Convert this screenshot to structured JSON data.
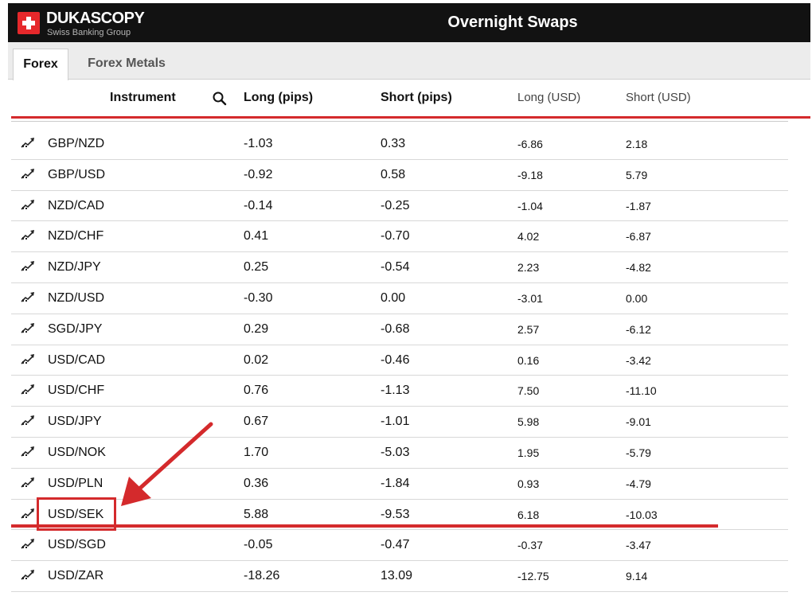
{
  "header": {
    "brand": "DUKASCOPY",
    "brand_sub": "Swiss Banking Group",
    "title": "Overnight Swaps",
    "brand_color": "#e6282b"
  },
  "tabs": [
    {
      "label": "Forex",
      "active": true
    },
    {
      "label": "Forex Metals",
      "active": false
    }
  ],
  "columns": {
    "instrument": "Instrument",
    "long_pips": "Long (pips)",
    "short_pips": "Short (pips)",
    "long_usd": "Long (USD)",
    "short_usd": "Short (USD)"
  },
  "rows": [
    {
      "instrument": "GBP/NZD",
      "long_pips": "-1.03",
      "short_pips": "0.33",
      "long_usd": "-6.86",
      "short_usd": "2.18"
    },
    {
      "instrument": "GBP/USD",
      "long_pips": "-0.92",
      "short_pips": "0.58",
      "long_usd": "-9.18",
      "short_usd": "5.79"
    },
    {
      "instrument": "NZD/CAD",
      "long_pips": "-0.14",
      "short_pips": "-0.25",
      "long_usd": "-1.04",
      "short_usd": "-1.87"
    },
    {
      "instrument": "NZD/CHF",
      "long_pips": "0.41",
      "short_pips": "-0.70",
      "long_usd": "4.02",
      "short_usd": "-6.87"
    },
    {
      "instrument": "NZD/JPY",
      "long_pips": "0.25",
      "short_pips": "-0.54",
      "long_usd": "2.23",
      "short_usd": "-4.82"
    },
    {
      "instrument": "NZD/USD",
      "long_pips": "-0.30",
      "short_pips": "0.00",
      "long_usd": "-3.01",
      "short_usd": "0.00"
    },
    {
      "instrument": "SGD/JPY",
      "long_pips": "0.29",
      "short_pips": "-0.68",
      "long_usd": "2.57",
      "short_usd": "-6.12"
    },
    {
      "instrument": "USD/CAD",
      "long_pips": "0.02",
      "short_pips": "-0.46",
      "long_usd": "0.16",
      "short_usd": "-3.42"
    },
    {
      "instrument": "USD/CHF",
      "long_pips": "0.76",
      "short_pips": "-1.13",
      "long_usd": "7.50",
      "short_usd": "-11.10"
    },
    {
      "instrument": "USD/JPY",
      "long_pips": "0.67",
      "short_pips": "-1.01",
      "long_usd": "5.98",
      "short_usd": "-9.01"
    },
    {
      "instrument": "USD/NOK",
      "long_pips": "1.70",
      "short_pips": "-5.03",
      "long_usd": "1.95",
      "short_usd": "-5.79"
    },
    {
      "instrument": "USD/PLN",
      "long_pips": "0.36",
      "short_pips": "-1.84",
      "long_usd": "0.93",
      "short_usd": "-4.79"
    },
    {
      "instrument": "USD/SEK",
      "long_pips": "5.88",
      "short_pips": "-9.53",
      "long_usd": "6.18",
      "short_usd": "-10.03"
    },
    {
      "instrument": "USD/SGD",
      "long_pips": "-0.05",
      "short_pips": "-0.47",
      "long_usd": "-0.37",
      "short_usd": "-3.47"
    },
    {
      "instrument": "USD/ZAR",
      "long_pips": "-18.26",
      "short_pips": "13.09",
      "long_usd": "-12.75",
      "short_usd": "9.14"
    }
  ],
  "annotation": {
    "highlighted_row": "USD/SEK",
    "color": "#d42a2c"
  },
  "icons": {
    "row_icon": "chart-icon",
    "search": "search-icon"
  }
}
